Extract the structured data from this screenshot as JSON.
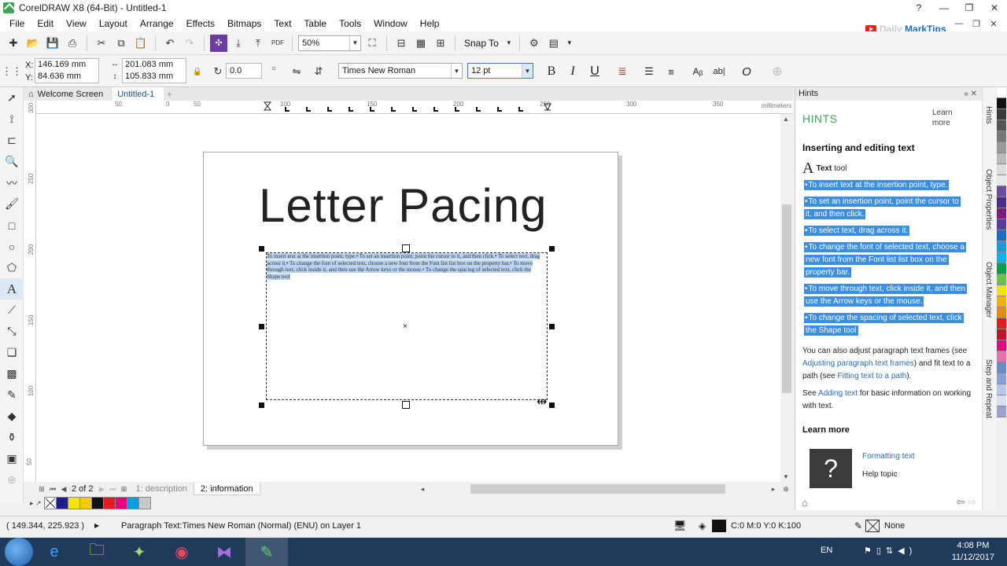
{
  "window": {
    "title": "CorelDRAW X8 (64-Bit) - Untitled-1",
    "controls": [
      "?",
      "—",
      "❐",
      "✕"
    ]
  },
  "menu": {
    "items": [
      "File",
      "Edit",
      "View",
      "Layout",
      "Arrange",
      "Effects",
      "Bitmaps",
      "Text",
      "Table",
      "Tools",
      "Window",
      "Help"
    ]
  },
  "watermark": {
    "brand": "Daily",
    "brand_bold": "MarkTips"
  },
  "toolbar": {
    "zoom": "50%",
    "snap_to": "Snap To"
  },
  "propbar": {
    "x_label": "X:",
    "x_value": "146.169 mm",
    "y_label": "Y:",
    "y_value": "84.636 mm",
    "width_value": "201.083 mm",
    "height_value": "105.833 mm",
    "rotation": "0.0",
    "font": "Times New Roman",
    "size": "12 pt"
  },
  "tabs": {
    "welcome": "Welcome Screen",
    "doc": "Untitled-1"
  },
  "ruler": {
    "unit": "millimeters",
    "h_ticks": [
      "50",
      "0",
      "50",
      "100",
      "150",
      "200",
      "250",
      "300",
      "350"
    ],
    "v_ticks": [
      "300",
      "250",
      "200",
      "150",
      "100",
      "50"
    ]
  },
  "canvas": {
    "heading": "Letter Pacing",
    "paragraph": "To insert text at the insertion point, type.• To set an insertion point, point the cursor to it, and then click.• To select text, drag across it.• To change the font of selected text, choose a new font from the Font list list box on the property bar.• To move through text, click inside it, and then use the Arrow keys or the mouse.• To change the spacing of selected text, click the Shape tool"
  },
  "pagebar": {
    "counter": "2",
    "of": "of 2",
    "page1": "1: description",
    "page2": "2: information"
  },
  "palette_bottom": {
    "colors": [
      "#1e1e8c",
      "#f2e600",
      "#f2cc00",
      "#111111",
      "#e31b23",
      "#e6007e",
      "#00a0e3",
      "#c8c8c8"
    ]
  },
  "hints": {
    "header": "Hints",
    "section": "HINTS",
    "learn_more_link": "Learn more",
    "title": "Inserting and editing text",
    "tool_label": "Text",
    "tool_suffix": "tool",
    "bullets": [
      "To insert text at the insertion point, type.",
      "To set an insertion point, point the cursor to it, and then click.",
      "To select text, drag across it.",
      "To change the font of selected text, choose a new font from the Font list list box on the property bar.",
      "To move through text, click inside it, and then use the Arrow keys or the mouse.",
      "To change the spacing of selected text, click the Shape tool"
    ],
    "para1_a": "You can also adjust paragraph text frames (see ",
    "para1_link1": "Adjusting paragraph text frames",
    "para1_b": ") and fit text to a path (see ",
    "para1_link2": "Fitting text to a path",
    "para1_c": ").",
    "para2_a": "See ",
    "para2_link": "Adding text",
    "para2_b": " for basic information on working with text.",
    "learn_more": "Learn more",
    "help_link": "Formatting text",
    "help_topic": "Help topic"
  },
  "docker_tabs": [
    "Hints",
    "Object Properties",
    "Object Manager",
    "Step and Repeat"
  ],
  "palette_right": {
    "colors": [
      "#ffffff",
      "#111111",
      "#3a3a3a",
      "#555555",
      "#777777",
      "#999999",
      "#bbbbbb",
      "#dddddd",
      "#e8e8e8",
      "#6a4fa0",
      "#4a2c8a",
      "#7a1e7a",
      "#5a3aa0",
      "#1e6ac8",
      "#1a9ad8",
      "#00b4e6",
      "#00a04a",
      "#6cc04a",
      "#f2e600",
      "#f2b300",
      "#e88a00",
      "#e31b23",
      "#c8102e",
      "#e6007e",
      "#f06eaa",
      "#6a8ac8",
      "#8aa0d8",
      "#b8c8e8",
      "#d8e0f0",
      "#a0a0d0"
    ]
  },
  "statusbar": {
    "coords": "( 149.344, 225.923 )",
    "info": "Paragraph Text:Times New Roman (Normal) (ENU) on Layer 1",
    "fill": "C:0 M:0 Y:0 K:100",
    "outline": "None"
  },
  "taskbar": {
    "lang": "EN",
    "time": "4:08 PM",
    "date": "11/12/2017"
  }
}
